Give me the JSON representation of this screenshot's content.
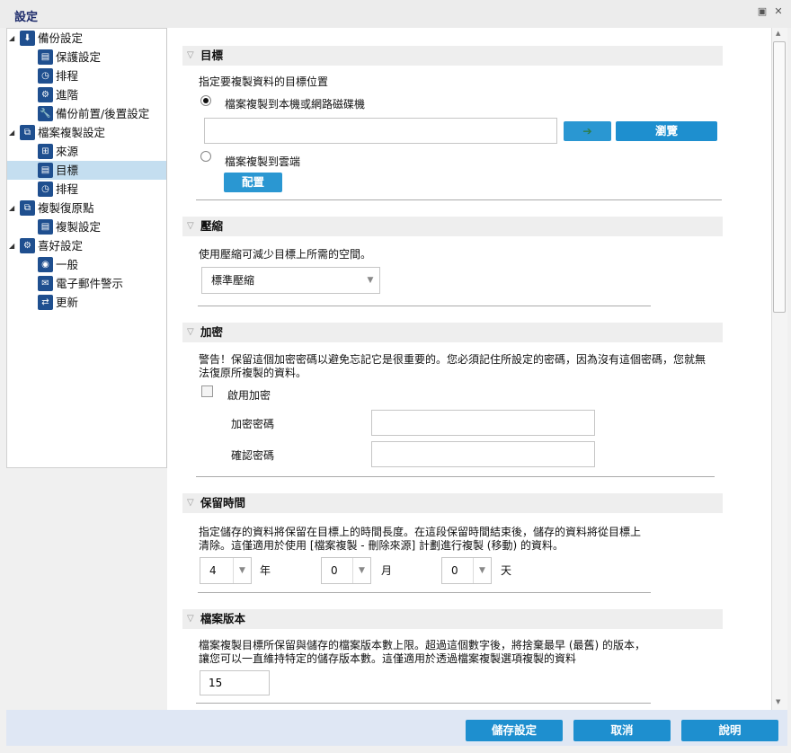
{
  "window": {
    "title": "設定"
  },
  "tree": [
    {
      "label": "備份設定",
      "level": 0,
      "icon": "backup-icon"
    },
    {
      "label": "保護設定",
      "level": 1,
      "icon": "target-icon"
    },
    {
      "label": "排程",
      "level": 1,
      "icon": "clock-icon"
    },
    {
      "label": "進階",
      "level": 1,
      "icon": "gears-icon"
    },
    {
      "label": "備份前置/後置設定",
      "level": 1,
      "icon": "wrench-icon"
    },
    {
      "label": "檔案複製設定",
      "level": 0,
      "icon": "file-copy-icon"
    },
    {
      "label": "來源",
      "level": 1,
      "icon": "network-icon"
    },
    {
      "label": "目標",
      "level": 1,
      "icon": "target-icon",
      "selected": true
    },
    {
      "label": "排程",
      "level": 1,
      "icon": "clock-icon"
    },
    {
      "label": "複製復原點",
      "level": 0,
      "icon": "copy-recovery-icon"
    },
    {
      "label": "複製設定",
      "level": 1,
      "icon": "target-icon"
    },
    {
      "label": "喜好設定",
      "level": 0,
      "icon": "preferences-icon"
    },
    {
      "label": "一般",
      "level": 1,
      "icon": "globe-icon"
    },
    {
      "label": "電子郵件警示",
      "level": 1,
      "icon": "mail-icon"
    },
    {
      "label": "更新",
      "level": 1,
      "icon": "update-icon"
    }
  ],
  "destination": {
    "title": "目標",
    "desc": "指定要複製資料的目標位置",
    "option_local": "檔案複製到本機或網路磁碟機",
    "path_value": "",
    "browse": "瀏覽",
    "option_cloud": "檔案複製到雲端",
    "configure": "配置"
  },
  "compression": {
    "title": "壓縮",
    "desc": "使用壓縮可減少目標上所需的空間。",
    "selected": "標準壓縮"
  },
  "encryption": {
    "title": "加密",
    "warning1": "警告！保留這個加密密碼以避免忘記它是很重要的。您必須記住所設定的密碼，因為沒有這個密碼，您就無",
    "warning2": "法復原所複製的資料。",
    "enable": "啟用加密",
    "password_label": "加密密碼",
    "confirm_label": "確認密碼"
  },
  "retention": {
    "title": "保留時間",
    "desc1": "指定儲存的資料將保留在目標上的時間長度。在這段保留時間結束後，儲存的資料將從目標上",
    "desc2": "清除。這僅適用於使用 [檔案複製 - 刪除來源] 計劃進行複製 (移動) 的資料。",
    "years": "4",
    "years_label": "年",
    "months": "0",
    "months_label": "月",
    "days": "0",
    "days_label": "天"
  },
  "versions": {
    "title": "檔案版本",
    "desc1": "檔案複製目標所保留與儲存的檔案版本數上限。超過這個數字後，將捨棄最早 (最舊) 的版本，",
    "desc2": "讓您可以一直維持特定的儲存版本數。這僅適用於透過檔案複製選項複製的資料",
    "value": "15"
  },
  "footer": {
    "save": "儲存設定",
    "cancel": "取消",
    "help": "說明"
  }
}
